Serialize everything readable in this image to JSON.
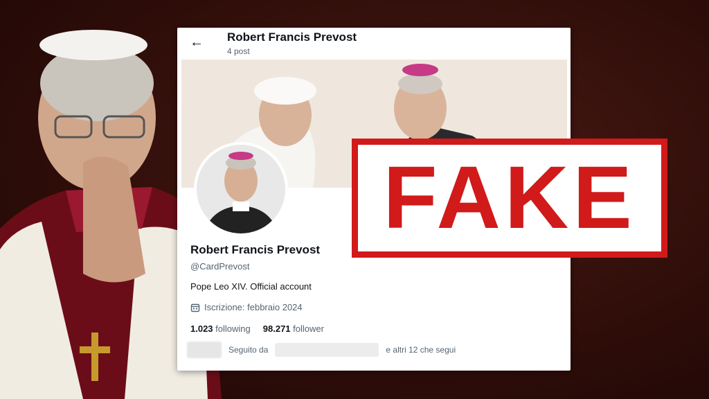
{
  "header": {
    "title": "Robert Francis Prevost",
    "posts": "4 post"
  },
  "profile": {
    "name": "Robert Francis Prevost",
    "handle": "@CardPrevost",
    "bio": "Pope Leo XIV. Official account",
    "joined": "Iscrizione: febbraio 2024",
    "following_count": "1.023",
    "following_label": "following",
    "followers_count": "98.271",
    "followers_label": "follower",
    "followed_by_prefix": "Seguito da",
    "followed_by_suffix": "e altri 12 che segui"
  },
  "stamp": {
    "text": "FAKE",
    "color": "#d11a1a"
  },
  "icons": {
    "back": "arrow-left-icon",
    "calendar": "calendar-icon"
  }
}
